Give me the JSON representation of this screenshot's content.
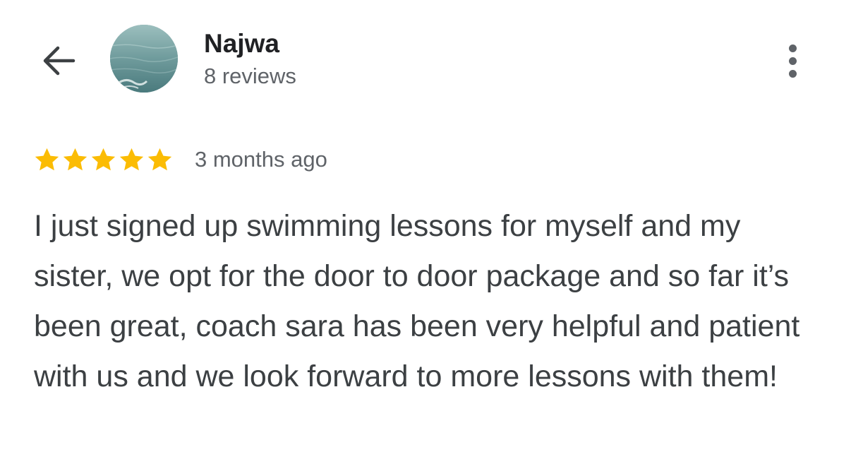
{
  "header": {
    "back_icon": "arrow-left-icon",
    "reviewer_name": "Najwa",
    "review_count": "8 reviews",
    "more_icon": "more-vertical-icon"
  },
  "review": {
    "rating": 5,
    "max_rating": 5,
    "star_color": "#fbbc04",
    "time": "3 months ago",
    "text": "I just signed up swimming lessons for myself and my sister, we opt for the door to door package and so far it’s been great, coach sara has been very helpful and patient with us and we look forward to more lessons with them!"
  }
}
